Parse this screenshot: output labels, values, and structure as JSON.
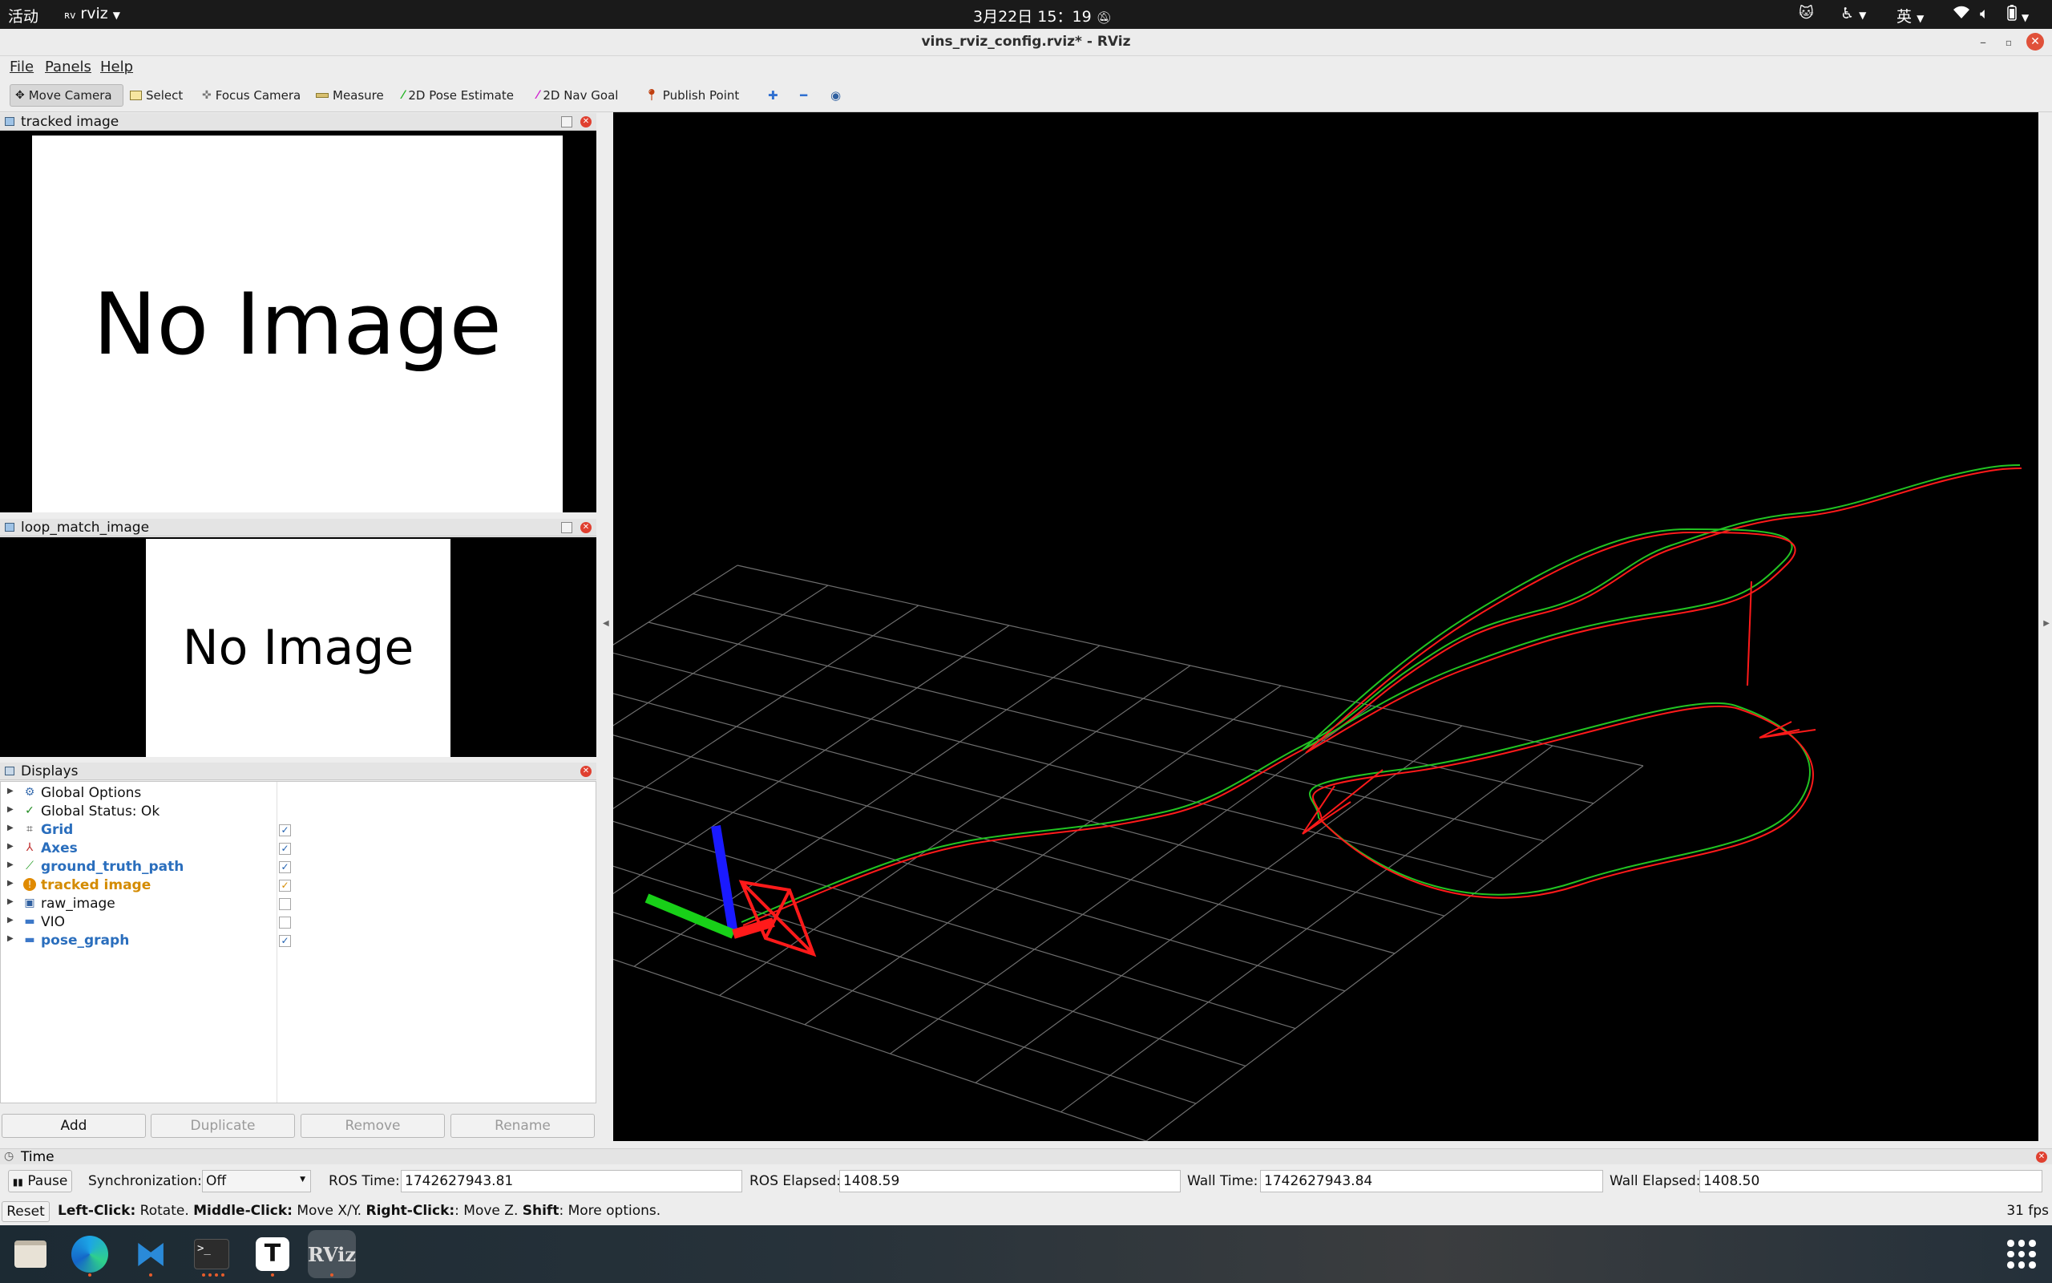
{
  "topbar": {
    "activities": "活动",
    "app_menu": "rviz",
    "clock": "3月22日  15：19",
    "ime": "英"
  },
  "window": {
    "title": "vins_rviz_config.rviz* - RViz"
  },
  "menu": {
    "file": "File",
    "panels": "Panels",
    "help": "Help"
  },
  "toolbar": {
    "move_camera": "Move Camera",
    "select": "Select",
    "focus_camera": "Focus Camera",
    "measure": "Measure",
    "pose_estimate": "2D Pose Estimate",
    "nav_goal": "2D Nav Goal",
    "publish_point": "Publish Point"
  },
  "panels": {
    "tracked_image": {
      "title": "tracked image",
      "placeholder": "No Image"
    },
    "loop_match": {
      "title": "loop_match_image",
      "placeholder": "No Image"
    },
    "displays": {
      "title": "Displays"
    }
  },
  "displays": {
    "items": [
      {
        "label": "Global Options",
        "checked": null,
        "style": "normal",
        "icon": "gear-icon"
      },
      {
        "label": "Global Status: Ok",
        "checked": null,
        "style": "normal",
        "icon": "check-icon"
      },
      {
        "label": "Grid",
        "checked": true,
        "style": "blue",
        "icon": "grid-icon"
      },
      {
        "label": "Axes",
        "checked": true,
        "style": "blue",
        "icon": "axes-icon"
      },
      {
        "label": "ground_truth_path",
        "checked": true,
        "style": "blue",
        "icon": "path-icon"
      },
      {
        "label": "tracked image",
        "checked": true,
        "style": "orange",
        "icon": "warning-icon"
      },
      {
        "label": "raw_image",
        "checked": false,
        "style": "normal",
        "icon": "image-icon"
      },
      {
        "label": "VIO",
        "checked": false,
        "style": "normal",
        "icon": "folder-icon"
      },
      {
        "label": "pose_graph",
        "checked": true,
        "style": "blue",
        "icon": "folder-icon"
      }
    ],
    "buttons": {
      "add": "Add",
      "duplicate": "Duplicate",
      "remove": "Remove",
      "rename": "Rename"
    }
  },
  "time": {
    "title": "Time",
    "pause": "Pause",
    "sync_label": "Synchronization:",
    "sync_value": "Off",
    "ros_time_label": "ROS Time:",
    "ros_time": "1742627943.81",
    "ros_elapsed_label": "ROS Elapsed:",
    "ros_elapsed": "1408.59",
    "wall_time_label": "Wall Time:",
    "wall_time": "1742627943.84",
    "wall_elapsed_label": "Wall Elapsed:",
    "wall_elapsed": "1408.50"
  },
  "status": {
    "reset": "Reset",
    "hint_left_bold": "Left-Click:",
    "hint_left": " Rotate. ",
    "hint_middle_bold": "Middle-Click:",
    "hint_middle": " Move X/Y. ",
    "hint_right_bold": "Right-Click:",
    "hint_right": ": Move Z. ",
    "hint_shift_bold": "Shift",
    "hint_shift": ": More options.",
    "fps": "31 fps"
  },
  "dock": {
    "rviz_label": "RViz",
    "text_label": "T"
  },
  "colors": {
    "path_green": "#22c322",
    "path_red": "#ff1a1a",
    "grid": "#6e6e6e"
  }
}
